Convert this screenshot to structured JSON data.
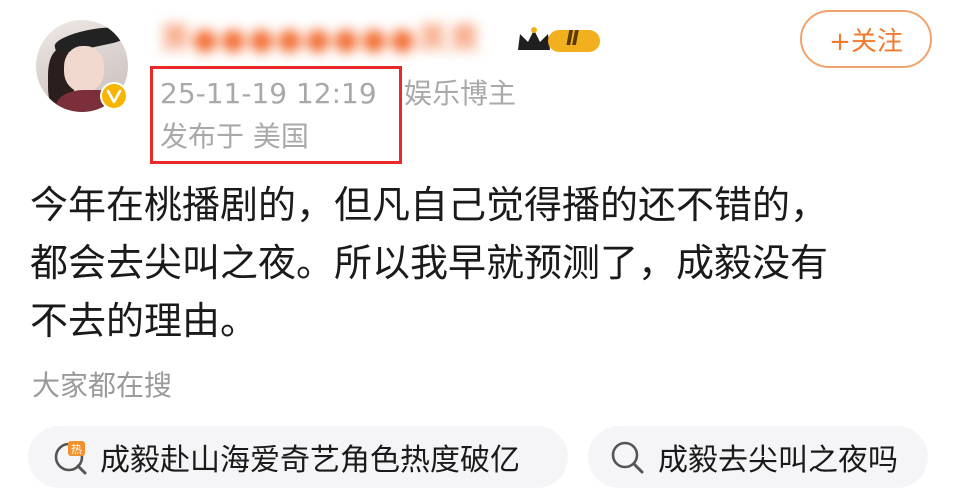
{
  "user": {
    "name": "萧●●●●●●●●黑黄",
    "rank_badge": "Ⅱ",
    "verified_icon": "v-verified-icon",
    "avatar_icon": "user-avatar"
  },
  "follow_button": {
    "label": "+关注"
  },
  "meta": {
    "time": "25-11-19 12:19",
    "tag": "娱乐博主",
    "location": "发布于 美国"
  },
  "post": {
    "lines": [
      "今年在桃播剧的，但凡自己觉得播的还不错的，",
      "都会去尖叫之夜。所以我早就预测了，成毅没有",
      "不去的理由。"
    ]
  },
  "search": {
    "heading": "大家都在搜",
    "items": [
      {
        "label": "成毅赴山海爱奇艺角色热度破亿",
        "icon": "hot-search-icon"
      },
      {
        "label": "成毅去尖叫之夜吗",
        "icon": "search-icon"
      }
    ]
  },
  "colors": {
    "accent_orange": "#f07a2e",
    "highlight_red": "#e8282a",
    "meta_gray": "#a9a9a9",
    "pill_bg": "#f5f5f7"
  }
}
